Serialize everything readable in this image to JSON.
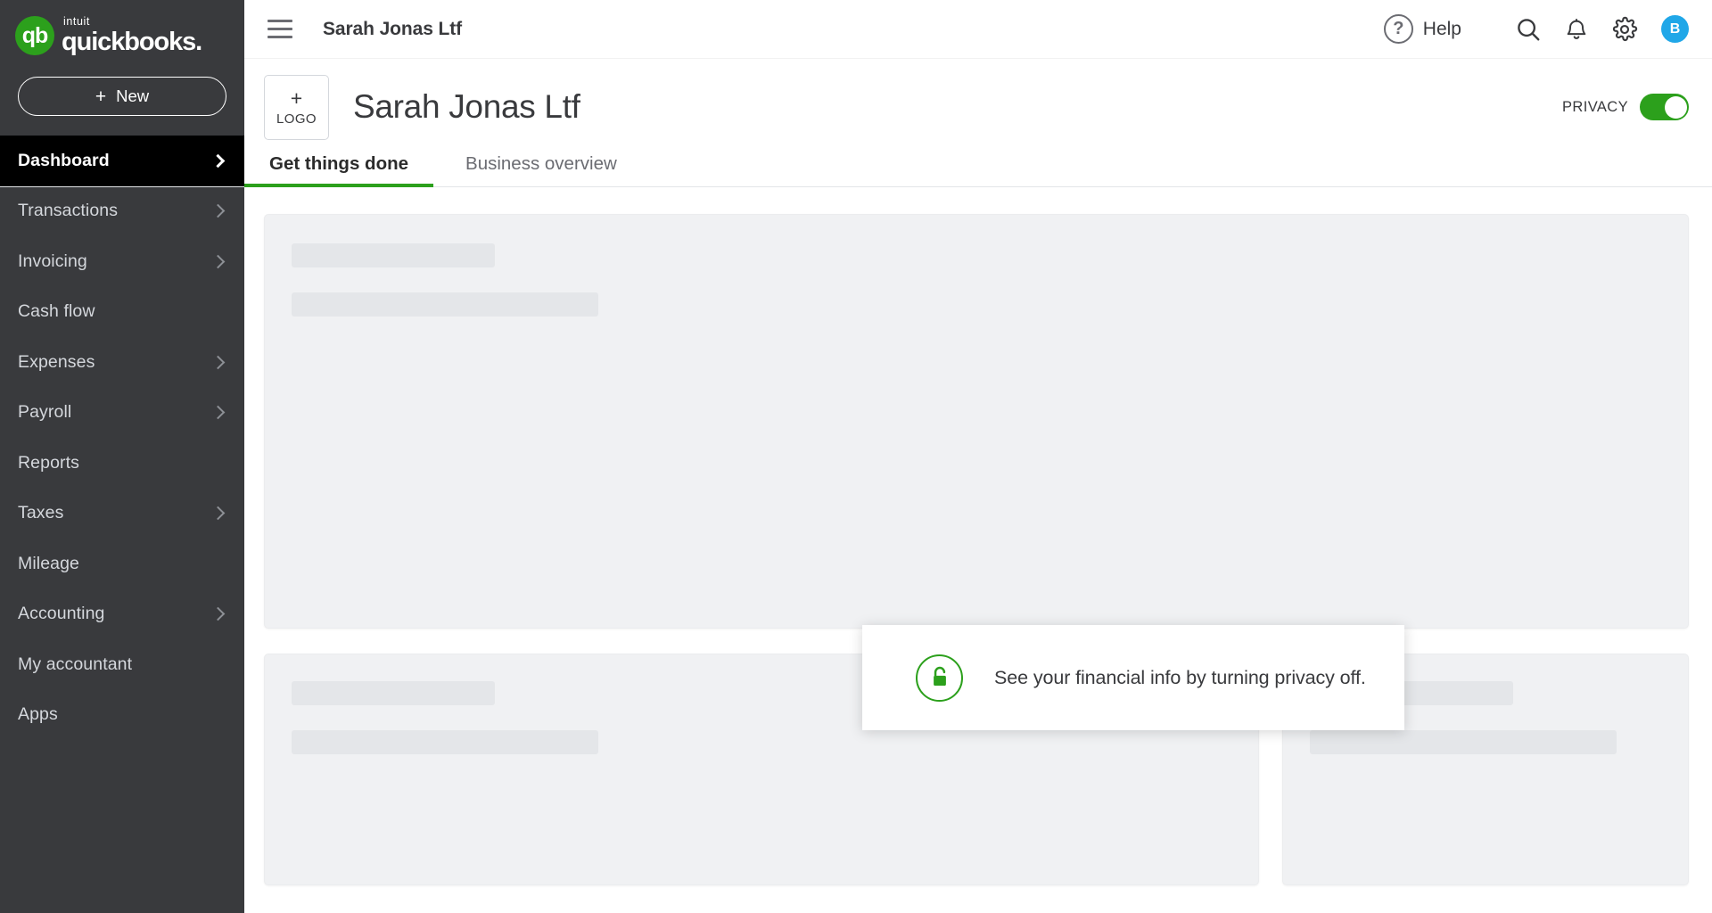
{
  "brand": {
    "intuit": "intuit",
    "product": "quickbooks.",
    "mark_letters": "qb",
    "new_button": "New",
    "plus": "+"
  },
  "sidebar": {
    "items": [
      {
        "label": "Dashboard",
        "active": true,
        "chevron": true
      },
      {
        "label": "Transactions",
        "active": false,
        "chevron": true
      },
      {
        "label": "Invoicing",
        "active": false,
        "chevron": true
      },
      {
        "label": "Cash flow",
        "active": false,
        "chevron": false
      },
      {
        "label": "Expenses",
        "active": false,
        "chevron": true
      },
      {
        "label": "Payroll",
        "active": false,
        "chevron": true
      },
      {
        "label": "Reports",
        "active": false,
        "chevron": false
      },
      {
        "label": "Taxes",
        "active": false,
        "chevron": true
      },
      {
        "label": "Mileage",
        "active": false,
        "chevron": false
      },
      {
        "label": "Accounting",
        "active": false,
        "chevron": true
      },
      {
        "label": "My accountant",
        "active": false,
        "chevron": false
      },
      {
        "label": "Apps",
        "active": false,
        "chevron": false
      }
    ]
  },
  "topbar": {
    "title": "Sarah Jonas Ltf",
    "help_label": "Help",
    "help_glyph": "?",
    "avatar_initial": "B"
  },
  "company": {
    "logo_plus": "+",
    "logo_label": "LOGO",
    "name": "Sarah Jonas Ltf",
    "privacy_label": "PRIVACY",
    "privacy_on": true
  },
  "tabs": [
    {
      "label": "Get things done",
      "active": true
    },
    {
      "label": "Business overview",
      "active": false
    }
  ],
  "modal": {
    "message": "See your financial info by turning privacy off."
  },
  "colors": {
    "brand_green": "#2ca01c",
    "sidebar_bg": "#393a3d",
    "active_nav_bg": "#000000",
    "avatar_blue": "#20a7e8",
    "card_bg": "#f0f1f3",
    "skeleton": "#e4e6e9"
  }
}
